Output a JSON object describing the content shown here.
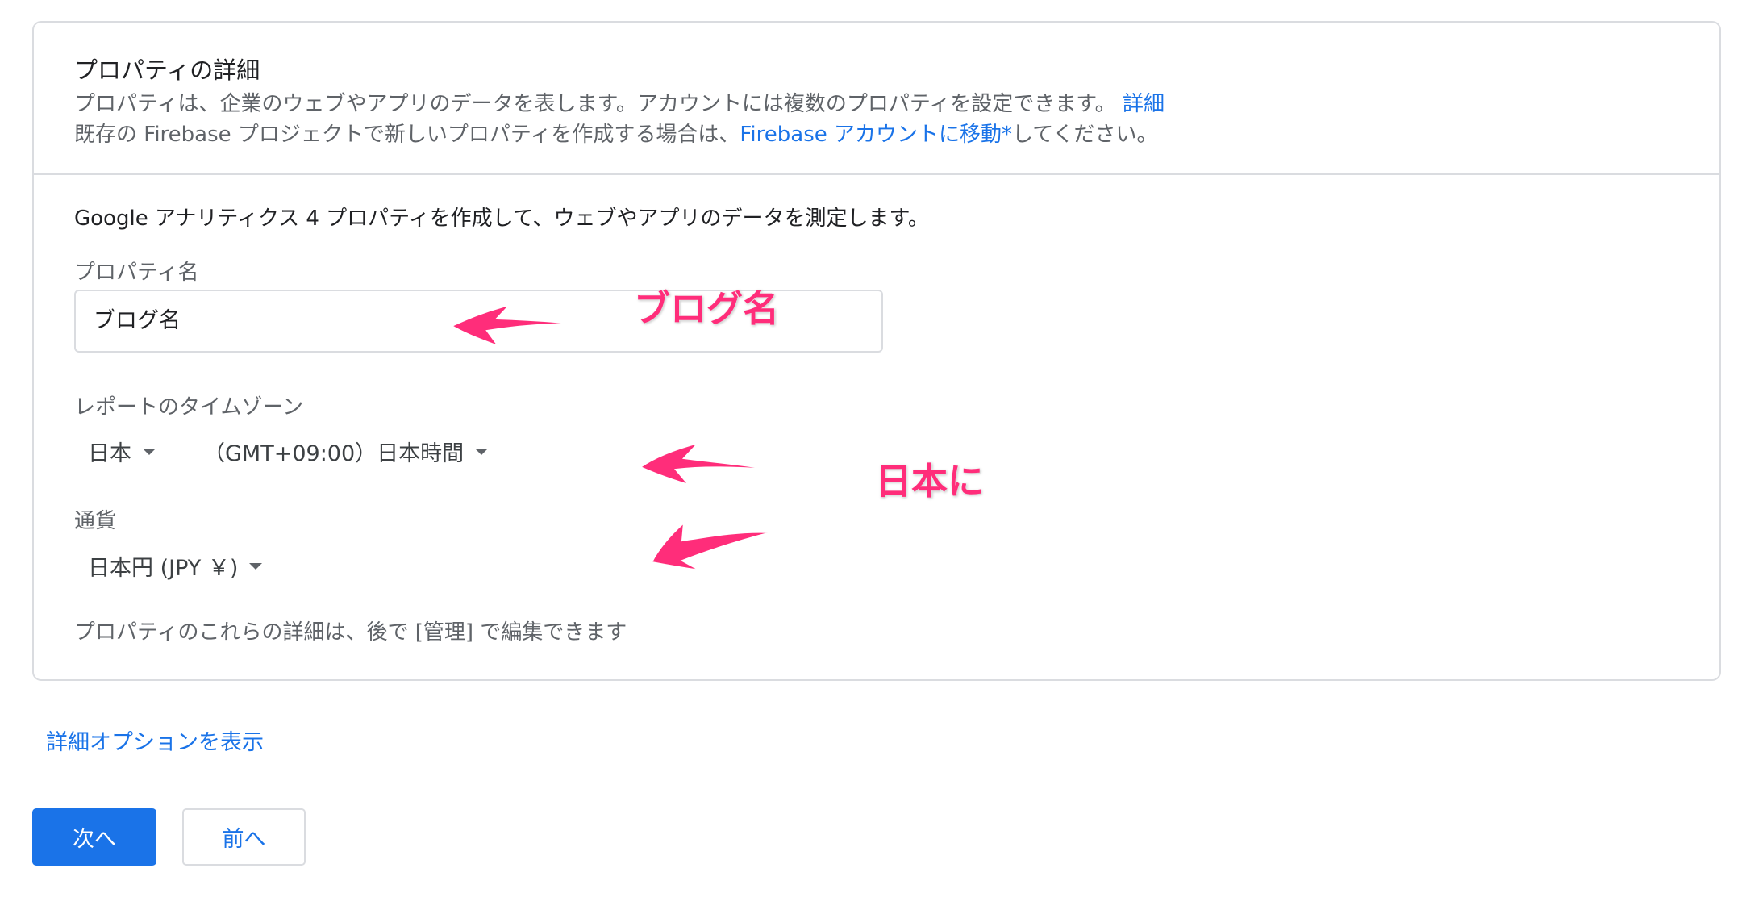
{
  "card": {
    "title": "プロパティの詳細",
    "desc_line1": "プロパティは、企業のウェブやアプリのデータを表します。アカウントには複数のプロパティを設定できます。",
    "desc_line1_link": "詳細",
    "desc_line2_prefix": "既存の Firebase プロジェクトで新しいプロパティを作成する場合は、",
    "desc_line2_link": "Firebase アカウントに移動*",
    "desc_line2_suffix": "してください。"
  },
  "form": {
    "intro": "Google アナリティクス 4 プロパティを作成して、ウェブやアプリのデータを測定します。",
    "property_name_label": "プロパティ名",
    "property_name_value": "ブログ名",
    "timezone_label": "レポートのタイムゾーン",
    "timezone_country": "日本",
    "timezone_value": "（GMT+09:00）日本時間",
    "currency_label": "通貨",
    "currency_value": "日本円 (JPY ￥)",
    "footnote": "プロパティのこれらの詳細は、後で [管理] で編集できます"
  },
  "advanced_link": "詳細オプションを表示",
  "buttons": {
    "next": "次へ",
    "prev": "前へ"
  },
  "annotations": {
    "blog_name": "ブログ名",
    "japan": "日本に",
    "color": "#ff2d7a"
  },
  "colors": {
    "accent": "#1a73e8",
    "border": "#dadce0"
  },
  "icons": [
    "dropdown-caret-icon",
    "annotation-arrow-icon"
  ]
}
